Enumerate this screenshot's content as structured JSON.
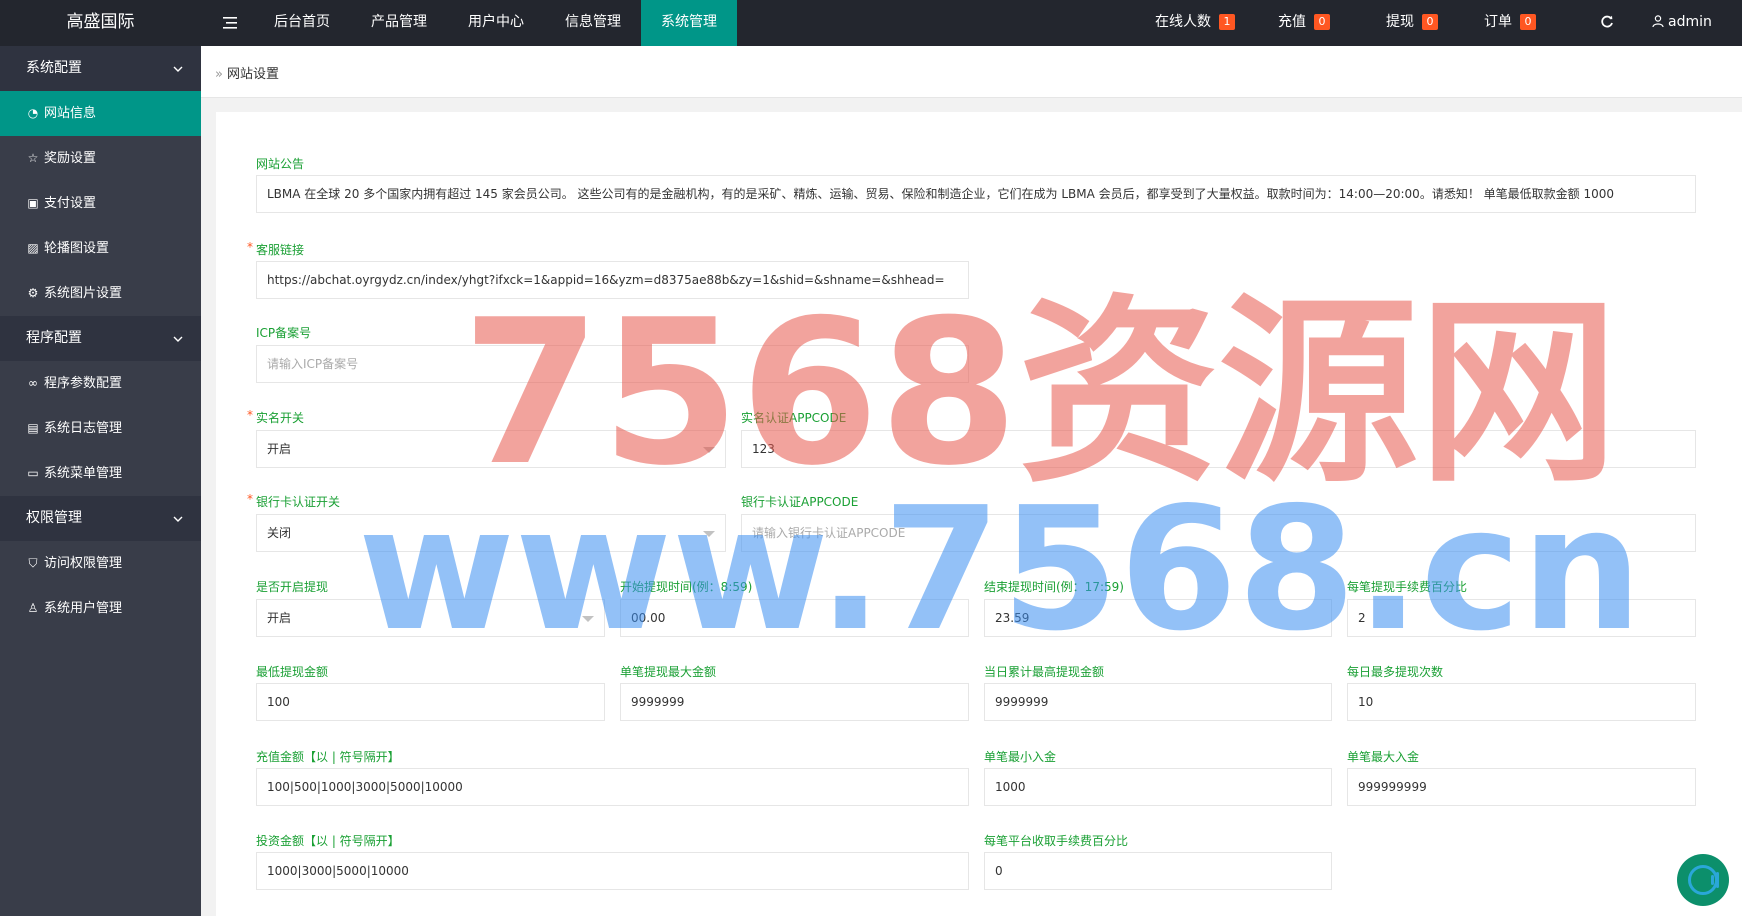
{
  "app": {
    "logo": "高盛国际",
    "menu_icon": "menu-icon"
  },
  "topnav": {
    "items": [
      {
        "label": "后台首页"
      },
      {
        "label": "产品管理"
      },
      {
        "label": "用户中心"
      },
      {
        "label": "信息管理"
      },
      {
        "label": "系统管理",
        "active": true
      }
    ]
  },
  "header_right": {
    "online": {
      "label": "在线人数",
      "count": "1"
    },
    "recharge": {
      "label": "充值",
      "count": "0"
    },
    "withdraw": {
      "label": "提现",
      "count": "0"
    },
    "orders": {
      "label": "订单",
      "count": "0"
    },
    "refresh_icon": "refresh-icon",
    "user": "admin"
  },
  "sidebar": {
    "groups": [
      {
        "label": "系统配置"
      },
      {
        "label": "程序配置"
      },
      {
        "label": "权限管理"
      }
    ],
    "items": [
      {
        "label": "网站信息",
        "icon": "dashboard-icon",
        "active": true
      },
      {
        "label": "奖励设置",
        "icon": "star-icon"
      },
      {
        "label": "支付设置",
        "icon": "money-icon"
      },
      {
        "label": "轮播图设置",
        "icon": "picture-icon"
      },
      {
        "label": "系统图片设置",
        "icon": "gear-icon"
      },
      {
        "label": "程序参数配置",
        "icon": "link-icon"
      },
      {
        "label": "系统日志管理",
        "icon": "log-icon"
      },
      {
        "label": "系统菜单管理",
        "icon": "table-icon"
      },
      {
        "label": "访问权限管理",
        "icon": "shield-icon"
      },
      {
        "label": "系统用户管理",
        "icon": "user-icon"
      }
    ]
  },
  "breadcrumb": {
    "current": "网站设置"
  },
  "form": {
    "notice": {
      "label": "网站公告",
      "value": "LBMA 在全球 20 多个国家内拥有超过 145 家会员公司。 这些公司有的是金融机构，有的是采矿、精炼、运输、贸易、保险和制造企业，它们在成为 LBMA 会员后，都享受到了大量权益。取款时间为：14:00—20:00。请悉知！ 单笔最低取款金额 1000"
    },
    "service_link": {
      "label": "客服链接",
      "value": "https://abchat.oyrgydz.cn/index/yhgt?ifxck=1&appid=16&yzm=d8375ae88b&zy=1&shid=&shname=&shhead="
    },
    "icp": {
      "label": "ICP备案号",
      "placeholder": "请输入ICP备案号"
    },
    "realname_switch": {
      "label": "实名开关",
      "value": "开启"
    },
    "realname_appcode": {
      "label": "实名认证APPCODE",
      "value": "123"
    },
    "bankcard_switch": {
      "label": "银行卡认证开关",
      "value": "关闭"
    },
    "bankcard_appcode": {
      "label": "银行卡认证APPCODE",
      "placeholder": "请输入银行卡认证APPCODE"
    },
    "withdraw_enabled": {
      "label": "是否开启提现",
      "value": "开启"
    },
    "withdraw_start": {
      "label": "开始提现时间(例：8:59)",
      "value": "00.00"
    },
    "withdraw_end": {
      "label": "结束提现时间(例：17:59)",
      "value": "23.59"
    },
    "withdraw_fee": {
      "label": "每笔提现手续费百分比",
      "value": "2"
    },
    "min_withdraw": {
      "label": "最低提现金额",
      "value": "100"
    },
    "max_withdraw_single": {
      "label": "单笔提现最大金额",
      "value": "9999999"
    },
    "max_withdraw_daily": {
      "label": "当日累计最高提现金额",
      "value": "9999999"
    },
    "max_withdraw_count": {
      "label": "每日最多提现次数",
      "value": "10"
    },
    "recharge_amounts": {
      "label": "充值金额【以 | 符号隔开】",
      "value": "100|500|1000|3000|5000|10000"
    },
    "min_deposit": {
      "label": "单笔最小入金",
      "value": "1000"
    },
    "max_deposit": {
      "label": "单笔最大入金",
      "value": "999999999"
    },
    "invest_amounts": {
      "label": "投资金额【以 | 符号隔开】",
      "value": "1000|3000|5000|10000"
    },
    "platform_fee": {
      "label": "每笔平台收取手续费百分比",
      "value": "0"
    }
  },
  "watermark": {
    "line1": "7568资源网",
    "line2": "www.7568.cn",
    "color1": "#e8584c",
    "color2": "#3b8ef0"
  },
  "floating_button_icon": "support-icon",
  "colors": {
    "accent": "#009688",
    "topbar": "#23262e",
    "sidebar": "#393d49",
    "badge": "#ff5722",
    "label": "#1aa034"
  }
}
